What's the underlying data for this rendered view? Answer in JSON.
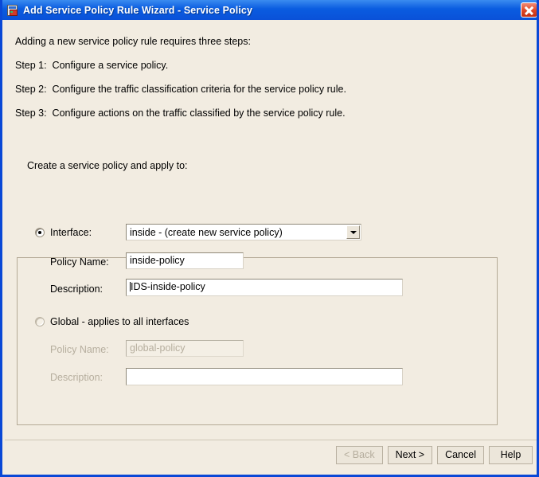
{
  "window": {
    "title": "Add Service Policy Rule Wizard - Service Policy",
    "icon": "wizard-document-icon",
    "close_label": "Close",
    "titlebar_color": "#0a51d8",
    "face_color": "#f2ece1"
  },
  "intro": {
    "line1": "Adding a new service policy rule requires three steps:",
    "line2": "Step 1:  Configure a service policy.",
    "line3": "Step 2:  Configure the traffic classification criteria for the service policy rule.",
    "line4": "Step 3:  Configure actions on the traffic classified by the service policy rule."
  },
  "form": {
    "apply_to_label": "Create a service policy and apply to:",
    "interface": {
      "radio_label": "Interface:",
      "selected": true,
      "combo_value": "inside - (create new service policy)",
      "combo_arrow_icon": "chevron-down-icon",
      "policy_name_label": "Policy Name:",
      "policy_name_value": "inside-policy",
      "description_label": "Description:",
      "description_value": "IDS-inside-policy"
    },
    "global": {
      "radio_label": "Global - applies to all interfaces",
      "selected": false,
      "enabled": false,
      "policy_name_label": "Policy Name:",
      "policy_name_value": "global-policy",
      "description_label": "Description:",
      "description_value": ""
    }
  },
  "footer": {
    "back_label": "< Back",
    "back_enabled": false,
    "next_label": "Next >",
    "cancel_label": "Cancel",
    "help_label": "Help"
  }
}
